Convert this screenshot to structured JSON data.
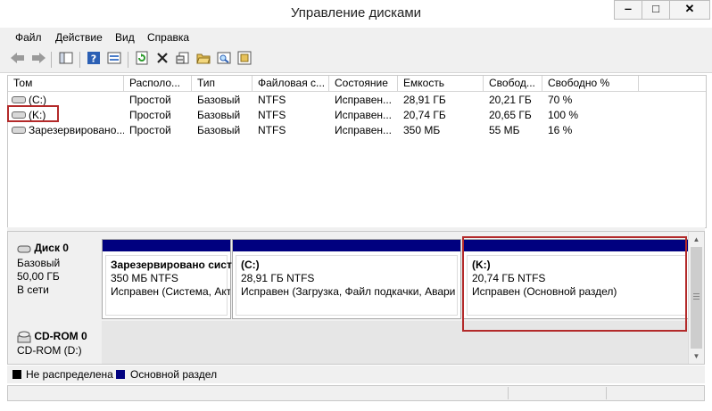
{
  "window": {
    "title": "Управление дисками",
    "controls": {
      "minimize": "‒",
      "maximize": "□",
      "close": "✕"
    }
  },
  "menu": [
    "Файл",
    "Действие",
    "Вид",
    "Справка"
  ],
  "toolbar_icons": [
    "back-arrow-icon",
    "forward-arrow-icon",
    "console-tree-icon",
    "help-icon",
    "properties-list-icon",
    "refresh-icon",
    "delete-icon",
    "properties-icon",
    "open-folder-icon",
    "search-drive-icon",
    "settings-icon"
  ],
  "volumes": {
    "columns": [
      "Том",
      "Располо...",
      "Тип",
      "Файловая с...",
      "Состояние",
      "Емкость",
      "Свобод...",
      "Свободно %"
    ],
    "rows": [
      [
        "(C:)",
        "Простой",
        "Базовый",
        "NTFS",
        "Исправен...",
        "28,91 ГБ",
        "20,21 ГБ",
        "70 %"
      ],
      [
        "(K:)",
        "Простой",
        "Базовый",
        "NTFS",
        "Исправен...",
        "20,74 ГБ",
        "20,65 ГБ",
        "100 %"
      ],
      [
        "Зарезервировано...",
        "Простой",
        "Базовый",
        "NTFS",
        "Исправен...",
        "350 МБ",
        "55 МБ",
        "16 %"
      ]
    ]
  },
  "disk0": {
    "name": "Диск 0",
    "type": "Базовый",
    "size": "50,00 ГБ",
    "status": "В сети",
    "partitions": [
      {
        "name": "Зарезервировано сист",
        "size": "350 МБ NTFS",
        "status": "Исправен (Система, Акт"
      },
      {
        "name": "(C:)",
        "size": "28,91 ГБ NTFS",
        "status": "Исправен (Загрузка, Файл подкачки, Аварий"
      },
      {
        "name": "(K:)",
        "size": "20,74 ГБ NTFS",
        "status": "Исправен (Основной раздел)"
      }
    ]
  },
  "cdrom0": {
    "name": "CD-ROM 0",
    "drive": "CD-ROM (D:)"
  },
  "legend": [
    {
      "label": "Не распределена",
      "color": "#000000"
    },
    {
      "label": "Основной раздел",
      "color": "#00007f"
    }
  ],
  "colors": {
    "primary_partition": "#00007f",
    "highlight_box": "#b32a2a"
  }
}
